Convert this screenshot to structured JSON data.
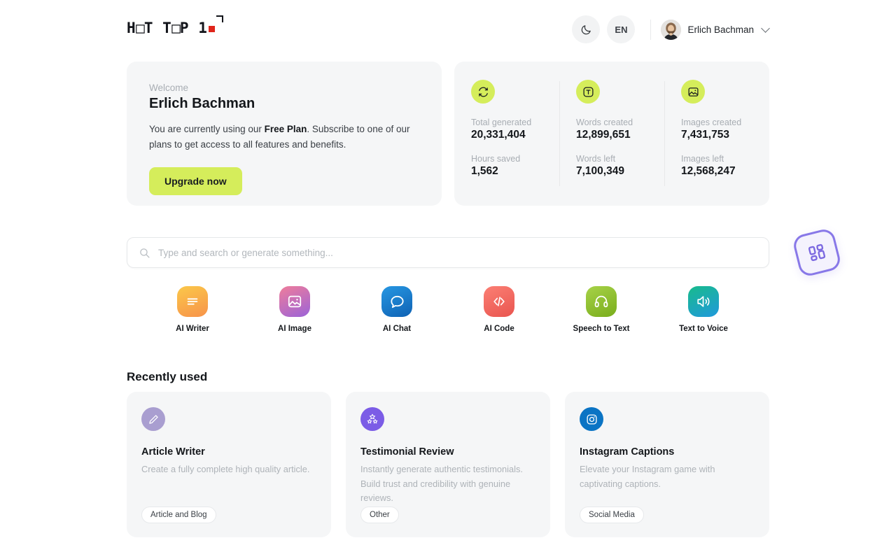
{
  "header": {
    "logo_text_a": "H",
    "logo_text_b": "T T",
    "logo_text_c": "P 1",
    "logo_alt": "HOT TOP 10",
    "theme_toggle_icon": "moon-icon",
    "language": "EN",
    "user_name": "Erlich Bachman",
    "chevron_icon": "chevron-down-icon"
  },
  "welcome": {
    "label": "Welcome",
    "name": "Erlich Bachman",
    "desc_part1": "You are currently using our ",
    "desc_plan": "Free Plan",
    "desc_part2": ". Subscribe to one of our plans to get access to all features and benefits.",
    "upgrade_label": "Upgrade now",
    "upgrade_color": "#d5ed5b"
  },
  "stats": {
    "icon_color": "#d5ed5b",
    "columns": [
      {
        "icon": "refresh-cycle-icon",
        "top_label": "Total generated",
        "top_value": "20,331,404",
        "bottom_label": "Hours saved",
        "bottom_value": "1,562"
      },
      {
        "icon": "text-t-icon",
        "top_label": "Words created",
        "top_value": "12,899,651",
        "bottom_label": "Words left",
        "bottom_value": "7,100,349"
      },
      {
        "icon": "image-icon",
        "top_label": "Images created",
        "top_value": "7,431,753",
        "bottom_label": "Images left",
        "bottom_value": "12,568,247"
      }
    ]
  },
  "search": {
    "icon": "search-icon",
    "placeholder": "Type and search or generate something...",
    "value": ""
  },
  "tiles": [
    {
      "label": "AI Writer",
      "icon": "text-lines-icon",
      "color_from": "#fbc84a",
      "color_to": "#f79a4a"
    },
    {
      "label": "AI Image",
      "icon": "image-icon",
      "color_from": "#ef7d9b",
      "color_to": "#9b63d8"
    },
    {
      "label": "AI Chat",
      "icon": "chat-bubble-icon",
      "color_from": "#1f8fdd",
      "color_to": "#1266b8"
    },
    {
      "label": "AI Code",
      "icon": "code-icon",
      "color_from": "#f9736b",
      "color_to": "#ea5a52"
    },
    {
      "label": "Speech to Text",
      "icon": "headphones-icon",
      "color_from": "#a3cf3e",
      "color_to": "#7fb222"
    },
    {
      "label": "Text to Voice",
      "icon": "speaker-icon",
      "color_from": "#1cb58f",
      "color_to": "#1f9fd6"
    }
  ],
  "recently_used": {
    "title": "Recently used",
    "cards": [
      {
        "icon": "pencil-icon",
        "icon_color": "#a99ed0",
        "title": "Article Writer",
        "desc": "Create a fully complete high quality article.",
        "tag": "Article and Blog"
      },
      {
        "icon": "stars-icon",
        "icon_color": "#7b5ce6",
        "title": "Testimonial Review",
        "desc": "Instantly generate authentic testimonials. Build trust and credibility with genuine reviews.",
        "tag": "Other"
      },
      {
        "icon": "instagram-icon",
        "icon_color": "#0b74c4",
        "title": "Instagram Captions",
        "desc": "Elevate your Instagram game with captivating captions.",
        "tag": "Social Media"
      }
    ]
  },
  "floating": {
    "icon": "grid-apps-icon",
    "color": "#8878e8"
  }
}
